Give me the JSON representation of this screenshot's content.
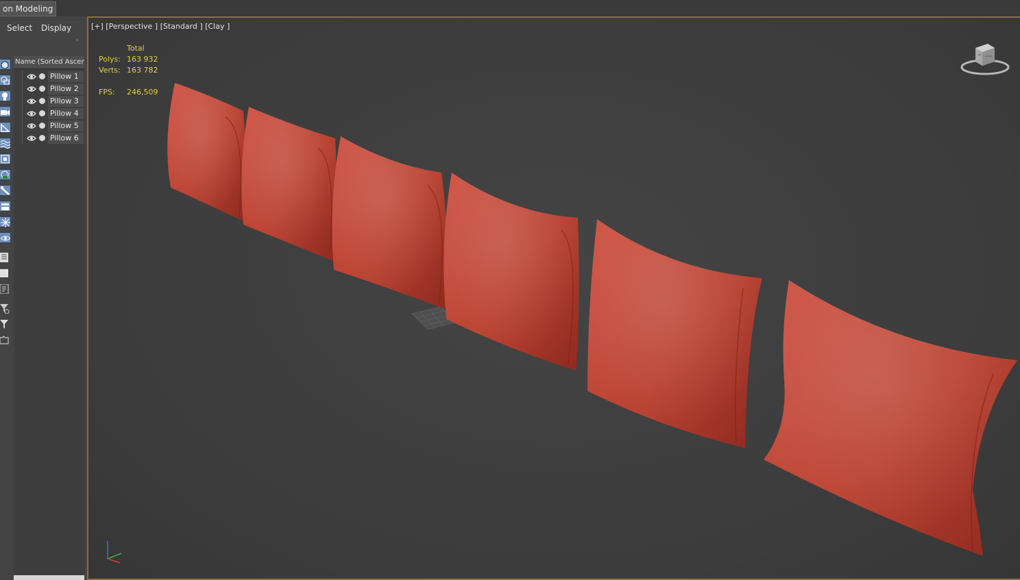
{
  "window": {
    "ribbon_tab": "on Modeling"
  },
  "scene_explorer": {
    "menu": [
      "Select",
      "Display"
    ],
    "column_header": "Name (Sorted Ascending)",
    "items": [
      {
        "label": "Pillow 1"
      },
      {
        "label": "Pillow 2"
      },
      {
        "label": "Pillow 3"
      },
      {
        "label": "Pillow 4"
      },
      {
        "label": "Pillow 5"
      },
      {
        "label": "Pillow 6"
      }
    ]
  },
  "viewport": {
    "label": "[+] [Perspective ] [Standard ] [Clay ]",
    "stats": {
      "header": "Total",
      "polys_label": "Polys:",
      "polys_value": "163 932",
      "verts_label": "Verts:",
      "verts_value": "163 782",
      "fps_label": "FPS:",
      "fps_value": "246,509"
    }
  },
  "colors": {
    "pillow": "#c0463a",
    "stats_text": "#e4cf4a",
    "viewport_border": "#8a7430",
    "toolbar_button": "#6f8fb8"
  },
  "icons": [
    "create-sphere-icon",
    "shapes-icon",
    "light-icon",
    "camera-icon",
    "helper-icon",
    "spacewarp-icon",
    "group-icon",
    "xref-icon",
    "bone-icon",
    "container-icon",
    "frozen-icon",
    "hidden-icon",
    "list-icon",
    "square-icon",
    "layer-icon",
    "filter-settings-icon",
    "filter-icon",
    "tag-icon"
  ]
}
